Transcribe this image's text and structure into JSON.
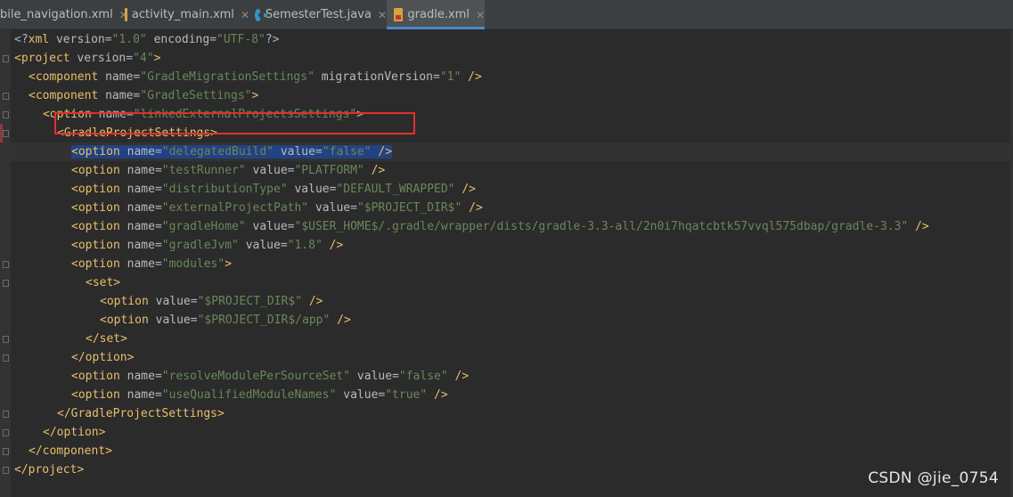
{
  "tabs": [
    {
      "label": "bile_navigation.xml",
      "icon": "xml-file-icon",
      "active": false
    },
    {
      "label": "activity_main.xml",
      "icon": "xml-file-icon",
      "active": false
    },
    {
      "label": "SemesterTest.java",
      "icon": "java-class-icon",
      "active": false
    },
    {
      "label": "gradle.xml",
      "icon": "xml-file-icon",
      "active": true
    }
  ],
  "close_glyph": "✕",
  "colors": {
    "editor_bg": "#2b2b2b",
    "tag": "#e8bf6a",
    "attribute": "#bababa",
    "value": "#6a8759",
    "selection": "#214283",
    "annotation_box": "#e03030"
  },
  "code": {
    "lines": [
      {
        "indent": 0,
        "tokens": [
          [
            "pun",
            "<?"
          ],
          [
            "tag",
            "xml"
          ],
          [
            "pun",
            " "
          ],
          [
            "attr",
            "version"
          ],
          [
            "pun",
            "="
          ],
          [
            "val",
            "\"1.0\""
          ],
          [
            "pun",
            " "
          ],
          [
            "attr",
            "encoding"
          ],
          [
            "pun",
            "="
          ],
          [
            "val",
            "\"UTF-8\""
          ],
          [
            "pun",
            "?>"
          ]
        ]
      },
      {
        "indent": 0,
        "tokens": [
          [
            "tag",
            "<project"
          ],
          [
            "pun",
            " "
          ],
          [
            "attr",
            "version"
          ],
          [
            "pun",
            "="
          ],
          [
            "val",
            "\"4\""
          ],
          [
            "tag",
            ">"
          ]
        ]
      },
      {
        "indent": 1,
        "tokens": [
          [
            "tag",
            "<component"
          ],
          [
            "pun",
            " "
          ],
          [
            "attr",
            "name"
          ],
          [
            "pun",
            "="
          ],
          [
            "val",
            "\"GradleMigrationSettings\""
          ],
          [
            "pun",
            " "
          ],
          [
            "attr",
            "migrationVersion"
          ],
          [
            "pun",
            "="
          ],
          [
            "val",
            "\"1\""
          ],
          [
            "pun",
            " "
          ],
          [
            "tag",
            "/>"
          ]
        ]
      },
      {
        "indent": 1,
        "tokens": [
          [
            "tag",
            "<component"
          ],
          [
            "pun",
            " "
          ],
          [
            "attr",
            "name"
          ],
          [
            "pun",
            "="
          ],
          [
            "val",
            "\"GradleSettings\""
          ],
          [
            "tag",
            ">"
          ]
        ]
      },
      {
        "indent": 2,
        "tokens": [
          [
            "tag",
            "<option"
          ],
          [
            "pun",
            " "
          ],
          [
            "attr",
            "name"
          ],
          [
            "pun",
            "="
          ],
          [
            "val",
            "\"linkedExternalProjectsSettings\""
          ],
          [
            "tag",
            ">"
          ]
        ]
      },
      {
        "indent": 3,
        "tokens": [
          [
            "tag",
            "<GradleProjectSettings>"
          ]
        ]
      },
      {
        "indent": 4,
        "tokens": [
          [
            "tag",
            "<option"
          ],
          [
            "pun",
            " "
          ],
          [
            "attr",
            "name"
          ],
          [
            "pun",
            "="
          ],
          [
            "val",
            "\"delegatedBuild\""
          ],
          [
            "pun",
            " "
          ],
          [
            "attr",
            "value"
          ],
          [
            "pun",
            "="
          ],
          [
            "val",
            "\"false\""
          ],
          [
            "pun",
            " "
          ],
          [
            "tag",
            "/>"
          ]
        ],
        "selected": true
      },
      {
        "indent": 4,
        "tokens": [
          [
            "tag",
            "<option"
          ],
          [
            "pun",
            " "
          ],
          [
            "attr",
            "name"
          ],
          [
            "pun",
            "="
          ],
          [
            "val",
            "\"testRunner\""
          ],
          [
            "pun",
            " "
          ],
          [
            "attr",
            "value"
          ],
          [
            "pun",
            "="
          ],
          [
            "val",
            "\"PLATFORM\""
          ],
          [
            "pun",
            " "
          ],
          [
            "tag",
            "/>"
          ]
        ]
      },
      {
        "indent": 4,
        "tokens": [
          [
            "tag",
            "<option"
          ],
          [
            "pun",
            " "
          ],
          [
            "attr",
            "name"
          ],
          [
            "pun",
            "="
          ],
          [
            "val",
            "\"distributionType\""
          ],
          [
            "pun",
            " "
          ],
          [
            "attr",
            "value"
          ],
          [
            "pun",
            "="
          ],
          [
            "val",
            "\"DEFAULT_WRAPPED\""
          ],
          [
            "pun",
            " "
          ],
          [
            "tag",
            "/>"
          ]
        ]
      },
      {
        "indent": 4,
        "tokens": [
          [
            "tag",
            "<option"
          ],
          [
            "pun",
            " "
          ],
          [
            "attr",
            "name"
          ],
          [
            "pun",
            "="
          ],
          [
            "val",
            "\"externalProjectPath\""
          ],
          [
            "pun",
            " "
          ],
          [
            "attr",
            "value"
          ],
          [
            "pun",
            "="
          ],
          [
            "val",
            "\"$PROJECT_DIR$\""
          ],
          [
            "pun",
            " "
          ],
          [
            "tag",
            "/>"
          ]
        ]
      },
      {
        "indent": 4,
        "tokens": [
          [
            "tag",
            "<option"
          ],
          [
            "pun",
            " "
          ],
          [
            "attr",
            "name"
          ],
          [
            "pun",
            "="
          ],
          [
            "val",
            "\"gradleHome\""
          ],
          [
            "pun",
            " "
          ],
          [
            "attr",
            "value"
          ],
          [
            "pun",
            "="
          ],
          [
            "val",
            "\"$USER_HOME$/.gradle/wrapper/dists/gradle-3.3-all/2n0i7hqatcbtk57vvql575dbap/gradle-3.3\""
          ],
          [
            "pun",
            " "
          ],
          [
            "tag",
            "/>"
          ]
        ]
      },
      {
        "indent": 4,
        "tokens": [
          [
            "tag",
            "<option"
          ],
          [
            "pun",
            " "
          ],
          [
            "attr",
            "name"
          ],
          [
            "pun",
            "="
          ],
          [
            "val",
            "\"gradleJvm\""
          ],
          [
            "pun",
            " "
          ],
          [
            "attr",
            "value"
          ],
          [
            "pun",
            "="
          ],
          [
            "val",
            "\"1.8\""
          ],
          [
            "pun",
            " "
          ],
          [
            "tag",
            "/>"
          ]
        ]
      },
      {
        "indent": 4,
        "tokens": [
          [
            "tag",
            "<option"
          ],
          [
            "pun",
            " "
          ],
          [
            "attr",
            "name"
          ],
          [
            "pun",
            "="
          ],
          [
            "val",
            "\"modules\""
          ],
          [
            "tag",
            ">"
          ]
        ]
      },
      {
        "indent": 5,
        "tokens": [
          [
            "tag",
            "<set>"
          ]
        ]
      },
      {
        "indent": 6,
        "tokens": [
          [
            "tag",
            "<option"
          ],
          [
            "pun",
            " "
          ],
          [
            "attr",
            "value"
          ],
          [
            "pun",
            "="
          ],
          [
            "val",
            "\"$PROJECT_DIR$\""
          ],
          [
            "pun",
            " "
          ],
          [
            "tag",
            "/>"
          ]
        ]
      },
      {
        "indent": 6,
        "tokens": [
          [
            "tag",
            "<option"
          ],
          [
            "pun",
            " "
          ],
          [
            "attr",
            "value"
          ],
          [
            "pun",
            "="
          ],
          [
            "val",
            "\"$PROJECT_DIR$/app\""
          ],
          [
            "pun",
            " "
          ],
          [
            "tag",
            "/>"
          ]
        ]
      },
      {
        "indent": 5,
        "tokens": [
          [
            "tag",
            "</set>"
          ]
        ]
      },
      {
        "indent": 4,
        "tokens": [
          [
            "tag",
            "</option>"
          ]
        ]
      },
      {
        "indent": 4,
        "tokens": [
          [
            "tag",
            "<option"
          ],
          [
            "pun",
            " "
          ],
          [
            "attr",
            "name"
          ],
          [
            "pun",
            "="
          ],
          [
            "val",
            "\"resolveModulePerSourceSet\""
          ],
          [
            "pun",
            " "
          ],
          [
            "attr",
            "value"
          ],
          [
            "pun",
            "="
          ],
          [
            "val",
            "\"false\""
          ],
          [
            "pun",
            " "
          ],
          [
            "tag",
            "/>"
          ]
        ]
      },
      {
        "indent": 4,
        "tokens": [
          [
            "tag",
            "<option"
          ],
          [
            "pun",
            " "
          ],
          [
            "attr",
            "name"
          ],
          [
            "pun",
            "="
          ],
          [
            "val",
            "\"useQualifiedModuleNames\""
          ],
          [
            "pun",
            " "
          ],
          [
            "attr",
            "value"
          ],
          [
            "pun",
            "="
          ],
          [
            "val",
            "\"true\""
          ],
          [
            "pun",
            " "
          ],
          [
            "tag",
            "/>"
          ]
        ]
      },
      {
        "indent": 3,
        "tokens": [
          [
            "tag",
            "</GradleProjectSettings>"
          ]
        ]
      },
      {
        "indent": 2,
        "tokens": [
          [
            "tag",
            "</option>"
          ]
        ]
      },
      {
        "indent": 1,
        "tokens": [
          [
            "tag",
            "</component>"
          ]
        ]
      },
      {
        "indent": 0,
        "tokens": [
          [
            "tag",
            "</project>"
          ]
        ]
      }
    ]
  },
  "watermark": "CSDN @jie_0754"
}
